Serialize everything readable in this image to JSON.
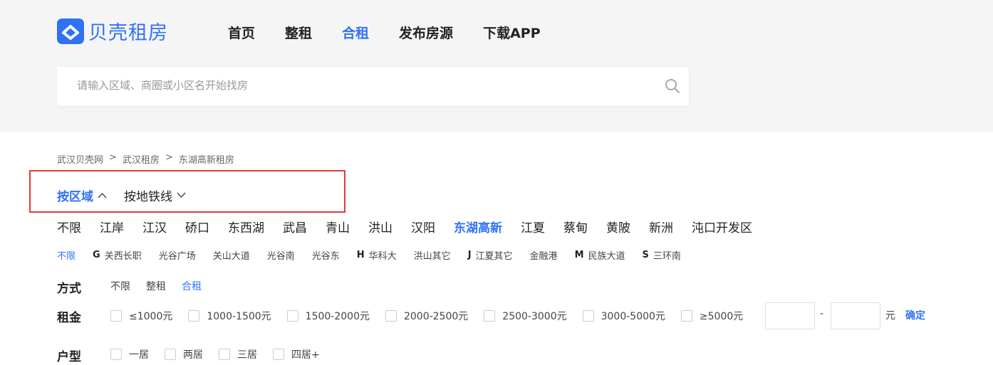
{
  "brand": {
    "name": "贝壳租房",
    "color": "#3072f6"
  },
  "nav": [
    {
      "label": "首页",
      "active": false
    },
    {
      "label": "整租",
      "active": false
    },
    {
      "label": "合租",
      "active": true
    },
    {
      "label": "发布房源",
      "active": false
    },
    {
      "label": "下载APP",
      "active": false
    }
  ],
  "search": {
    "placeholder": "请输入区域、商圈或小区名开始找房",
    "icon": "search-icon"
  },
  "breadcrumb": [
    "武汉贝壳网",
    "武汉租房",
    "东湖高新租房"
  ],
  "breadcrumb_sep": ">",
  "mode_tabs": [
    {
      "label": "按区域",
      "active": true,
      "icon": "chevron-up-icon"
    },
    {
      "label": "按地铁线",
      "active": false,
      "icon": "chevron-down-icon"
    }
  ],
  "districts": [
    "不限",
    "江岸",
    "江汉",
    "硚口",
    "东西湖",
    "武昌",
    "青山",
    "洪山",
    "汉阳",
    "东湖高新",
    "江夏",
    "蔡甸",
    "黄陂",
    "新洲",
    "沌口开发区"
  ],
  "active_district": "东湖高新",
  "subareas": [
    {
      "letter": "",
      "label": "不限",
      "active": true
    },
    {
      "letter": "G",
      "label": "关西长职",
      "active": false
    },
    {
      "letter": "",
      "label": "光谷广场",
      "active": false
    },
    {
      "letter": "",
      "label": "关山大道",
      "active": false
    },
    {
      "letter": "",
      "label": "光谷南",
      "active": false
    },
    {
      "letter": "",
      "label": "光谷东",
      "active": false
    },
    {
      "letter": "H",
      "label": "华科大",
      "active": false
    },
    {
      "letter": "",
      "label": "洪山其它",
      "active": false
    },
    {
      "letter": "J",
      "label": "江夏其它",
      "active": false
    },
    {
      "letter": "",
      "label": "金融港",
      "active": false
    },
    {
      "letter": "M",
      "label": "民族大道",
      "active": false
    },
    {
      "letter": "S",
      "label": "三环南",
      "active": false
    }
  ],
  "filters": {
    "mode": {
      "label": "方式",
      "options": [
        {
          "label": "不限",
          "active": false
        },
        {
          "label": "整租",
          "active": false
        },
        {
          "label": "合租",
          "active": true
        }
      ]
    },
    "rent": {
      "label": "租金",
      "options": [
        "≤1000元",
        "1000-1500元",
        "1500-2000元",
        "2000-2500元",
        "2500-3000元",
        "3000-5000元",
        "≥5000元"
      ],
      "min_value": "",
      "max_value": "",
      "dash": "-",
      "unit": "元",
      "confirm": "确定"
    },
    "layout": {
      "label": "户型",
      "options": [
        "一居",
        "两居",
        "三居",
        "四居+"
      ]
    }
  }
}
